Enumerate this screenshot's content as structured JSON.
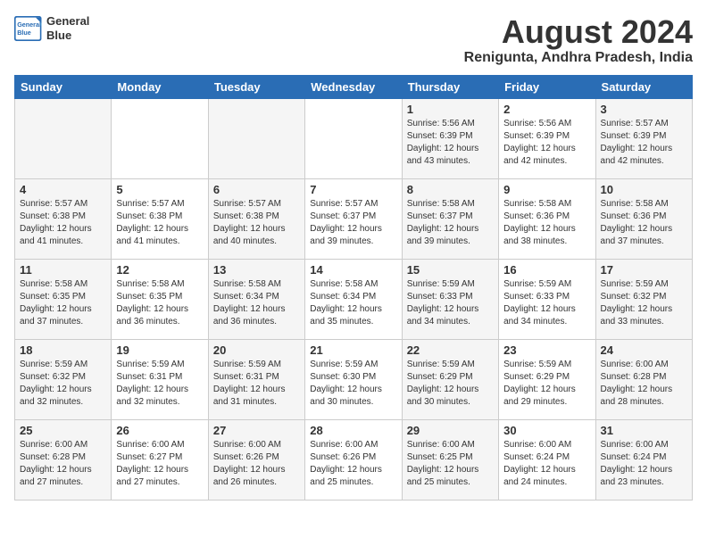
{
  "header": {
    "logo_line1": "General",
    "logo_line2": "Blue",
    "month_year": "August 2024",
    "location": "Renigunta, Andhra Pradesh, India"
  },
  "weekdays": [
    "Sunday",
    "Monday",
    "Tuesday",
    "Wednesday",
    "Thursday",
    "Friday",
    "Saturday"
  ],
  "weeks": [
    [
      {
        "day": "",
        "info": ""
      },
      {
        "day": "",
        "info": ""
      },
      {
        "day": "",
        "info": ""
      },
      {
        "day": "",
        "info": ""
      },
      {
        "day": "1",
        "info": "Sunrise: 5:56 AM\nSunset: 6:39 PM\nDaylight: 12 hours\nand 43 minutes."
      },
      {
        "day": "2",
        "info": "Sunrise: 5:56 AM\nSunset: 6:39 PM\nDaylight: 12 hours\nand 42 minutes."
      },
      {
        "day": "3",
        "info": "Sunrise: 5:57 AM\nSunset: 6:39 PM\nDaylight: 12 hours\nand 42 minutes."
      }
    ],
    [
      {
        "day": "4",
        "info": "Sunrise: 5:57 AM\nSunset: 6:38 PM\nDaylight: 12 hours\nand 41 minutes."
      },
      {
        "day": "5",
        "info": "Sunrise: 5:57 AM\nSunset: 6:38 PM\nDaylight: 12 hours\nand 41 minutes."
      },
      {
        "day": "6",
        "info": "Sunrise: 5:57 AM\nSunset: 6:38 PM\nDaylight: 12 hours\nand 40 minutes."
      },
      {
        "day": "7",
        "info": "Sunrise: 5:57 AM\nSunset: 6:37 PM\nDaylight: 12 hours\nand 39 minutes."
      },
      {
        "day": "8",
        "info": "Sunrise: 5:58 AM\nSunset: 6:37 PM\nDaylight: 12 hours\nand 39 minutes."
      },
      {
        "day": "9",
        "info": "Sunrise: 5:58 AM\nSunset: 6:36 PM\nDaylight: 12 hours\nand 38 minutes."
      },
      {
        "day": "10",
        "info": "Sunrise: 5:58 AM\nSunset: 6:36 PM\nDaylight: 12 hours\nand 37 minutes."
      }
    ],
    [
      {
        "day": "11",
        "info": "Sunrise: 5:58 AM\nSunset: 6:35 PM\nDaylight: 12 hours\nand 37 minutes."
      },
      {
        "day": "12",
        "info": "Sunrise: 5:58 AM\nSunset: 6:35 PM\nDaylight: 12 hours\nand 36 minutes."
      },
      {
        "day": "13",
        "info": "Sunrise: 5:58 AM\nSunset: 6:34 PM\nDaylight: 12 hours\nand 36 minutes."
      },
      {
        "day": "14",
        "info": "Sunrise: 5:58 AM\nSunset: 6:34 PM\nDaylight: 12 hours\nand 35 minutes."
      },
      {
        "day": "15",
        "info": "Sunrise: 5:59 AM\nSunset: 6:33 PM\nDaylight: 12 hours\nand 34 minutes."
      },
      {
        "day": "16",
        "info": "Sunrise: 5:59 AM\nSunset: 6:33 PM\nDaylight: 12 hours\nand 34 minutes."
      },
      {
        "day": "17",
        "info": "Sunrise: 5:59 AM\nSunset: 6:32 PM\nDaylight: 12 hours\nand 33 minutes."
      }
    ],
    [
      {
        "day": "18",
        "info": "Sunrise: 5:59 AM\nSunset: 6:32 PM\nDaylight: 12 hours\nand 32 minutes."
      },
      {
        "day": "19",
        "info": "Sunrise: 5:59 AM\nSunset: 6:31 PM\nDaylight: 12 hours\nand 32 minutes."
      },
      {
        "day": "20",
        "info": "Sunrise: 5:59 AM\nSunset: 6:31 PM\nDaylight: 12 hours\nand 31 minutes."
      },
      {
        "day": "21",
        "info": "Sunrise: 5:59 AM\nSunset: 6:30 PM\nDaylight: 12 hours\nand 30 minutes."
      },
      {
        "day": "22",
        "info": "Sunrise: 5:59 AM\nSunset: 6:29 PM\nDaylight: 12 hours\nand 30 minutes."
      },
      {
        "day": "23",
        "info": "Sunrise: 5:59 AM\nSunset: 6:29 PM\nDaylight: 12 hours\nand 29 minutes."
      },
      {
        "day": "24",
        "info": "Sunrise: 6:00 AM\nSunset: 6:28 PM\nDaylight: 12 hours\nand 28 minutes."
      }
    ],
    [
      {
        "day": "25",
        "info": "Sunrise: 6:00 AM\nSunset: 6:28 PM\nDaylight: 12 hours\nand 27 minutes."
      },
      {
        "day": "26",
        "info": "Sunrise: 6:00 AM\nSunset: 6:27 PM\nDaylight: 12 hours\nand 27 minutes."
      },
      {
        "day": "27",
        "info": "Sunrise: 6:00 AM\nSunset: 6:26 PM\nDaylight: 12 hours\nand 26 minutes."
      },
      {
        "day": "28",
        "info": "Sunrise: 6:00 AM\nSunset: 6:26 PM\nDaylight: 12 hours\nand 25 minutes."
      },
      {
        "day": "29",
        "info": "Sunrise: 6:00 AM\nSunset: 6:25 PM\nDaylight: 12 hours\nand 25 minutes."
      },
      {
        "day": "30",
        "info": "Sunrise: 6:00 AM\nSunset: 6:24 PM\nDaylight: 12 hours\nand 24 minutes."
      },
      {
        "day": "31",
        "info": "Sunrise: 6:00 AM\nSunset: 6:24 PM\nDaylight: 12 hours\nand 23 minutes."
      }
    ]
  ]
}
